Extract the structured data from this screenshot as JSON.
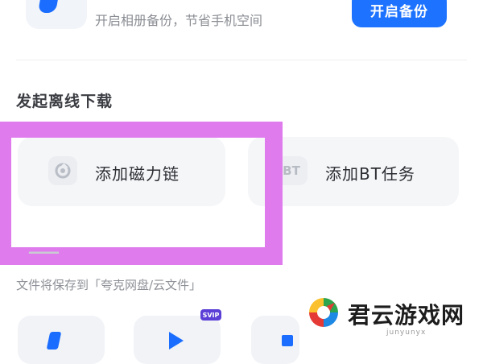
{
  "backup": {
    "text": "开启相册备份，节省手机空间",
    "button_label": "开启备份"
  },
  "offline_download": {
    "section_title": "发起离线下载",
    "magnet_label": "添加磁力链",
    "bt_icon_text": "BT",
    "bt_label": "添加BT任务"
  },
  "save_hint": "文件将保存到「夸克网盘/云文件」",
  "bottom_tiles": {
    "badge": "SVIP"
  },
  "watermark": {
    "name": "君云游戏网",
    "domain": "junyunyx"
  },
  "colors": {
    "accent": "#1d73ff",
    "highlight": "#e07bee",
    "card_bg": "#f5f6f8"
  }
}
